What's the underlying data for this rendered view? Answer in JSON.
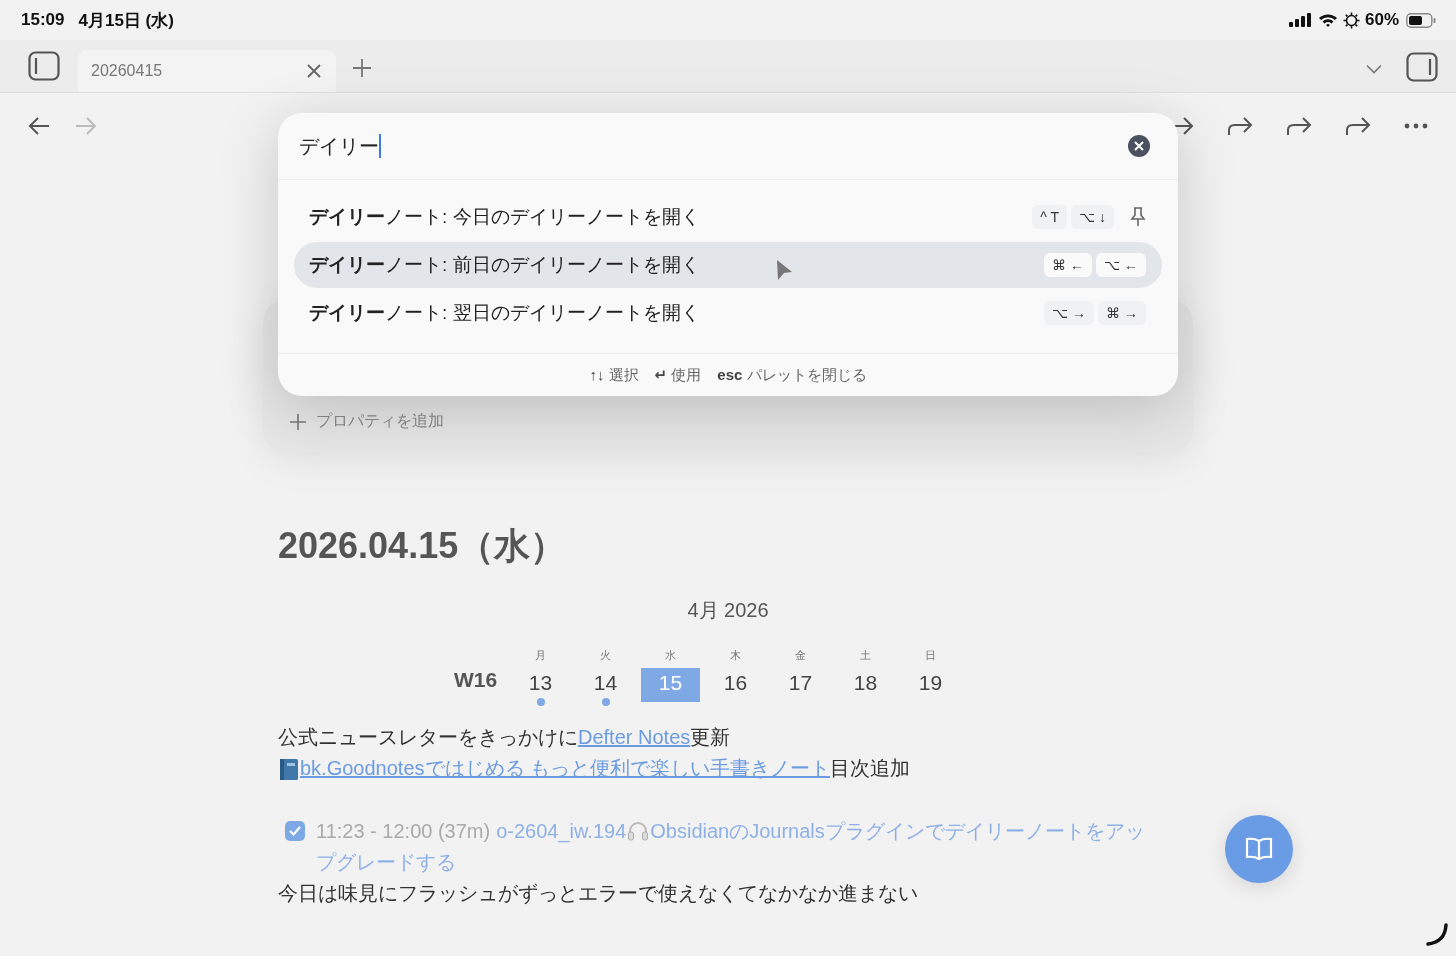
{
  "status_bar": {
    "time": "15:09",
    "date": "4月15日 (水)",
    "battery": "60%"
  },
  "tabs": [
    {
      "label": "20260415"
    }
  ],
  "nav": {
    "back_disabled": false,
    "forward_disabled": true
  },
  "properties": {
    "add_label": "プロパティを追加"
  },
  "palette": {
    "query": "デイリー",
    "items": [
      {
        "label": "**デイリー**ノート: 今日のデイリーノートを開く",
        "keys": [
          "^ T",
          "⌥ ↓"
        ],
        "pin": true,
        "selected": false
      },
      {
        "label": "**デイリー**ノート: 前日のデイリーノートを開く",
        "keys": [
          "⌘ ←",
          "⌥ ←"
        ],
        "pin": false,
        "selected": true
      },
      {
        "label": "**デイリー**ノート: 翌日のデイリーノートを開く",
        "keys": [
          "⌥ →",
          "⌘ →"
        ],
        "pin": false,
        "selected": false
      }
    ],
    "hints": [
      {
        "key": "↑↓",
        "label": "選択"
      },
      {
        "key": "↵",
        "label": "使用"
      },
      {
        "key": "esc",
        "label": "パレットを閉じる"
      }
    ]
  },
  "note": {
    "title": "2026.04.15（水）",
    "calendar": {
      "month": "4月  2026",
      "week": "W16",
      "days": [
        {
          "weekday": "月",
          "day": "13",
          "has_notes": true,
          "selected": false
        },
        {
          "weekday": "火",
          "day": "14",
          "has_notes": true,
          "selected": false
        },
        {
          "weekday": "水",
          "day": "15",
          "has_notes": false,
          "selected": true
        },
        {
          "weekday": "木",
          "day": "16",
          "has_notes": false,
          "selected": false
        },
        {
          "weekday": "金",
          "day": "17",
          "has_notes": false,
          "selected": false
        },
        {
          "weekday": "土",
          "day": "18",
          "has_notes": false,
          "selected": false
        },
        {
          "weekday": "日",
          "day": "19",
          "has_notes": false,
          "selected": false
        }
      ]
    },
    "paragraphs": [
      {
        "kind": "text",
        "before": "公式ニュースレターをきっかけに",
        "link": "Defter Notes",
        "after": "更新"
      },
      {
        "kind": "book",
        "link": " bk.Goodnotesではじめる もっと便利で楽しい手書きノート",
        "after": "目次追加"
      },
      {
        "kind": "task",
        "checked": true,
        "time": "11:23 - 12:00 (37m)",
        "code": "o-2604_iw.194",
        "link": "ObsidianのJournalsプラグインでデイリーノートをアップグレードする"
      },
      {
        "kind": "text",
        "before": "今日は味見にフラッシュがずっとエラーで使えなくてなかなか進まない"
      }
    ]
  }
}
